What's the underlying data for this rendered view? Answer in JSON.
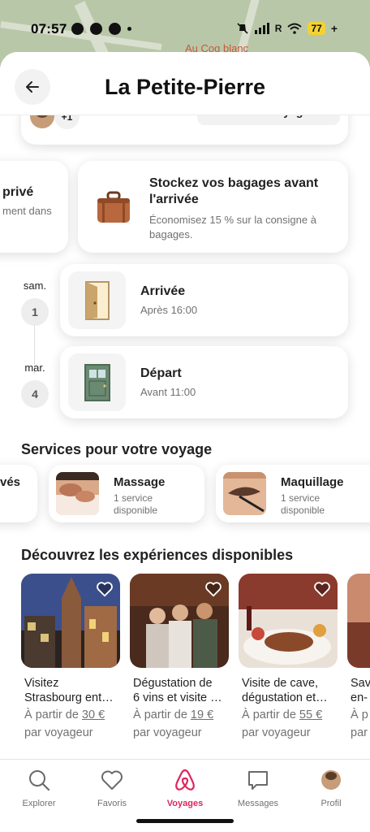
{
  "status_bar": {
    "time": "07:57",
    "network": "R",
    "battery": "77"
  },
  "map": {
    "label": "Au Coq blanc"
  },
  "header": {
    "title": "La Petite-Pierre"
  },
  "guests": {
    "extra_count": "+1",
    "invite_label": "Inviter des voyageurs"
  },
  "private_card": {
    "title": "privé",
    "subtitle": "ment dans"
  },
  "luggage_card": {
    "title": "Stockez vos bagages avant l'arrivée",
    "subtitle": "Économisez 15 % sur la consigne à bagages."
  },
  "schedule": [
    {
      "day_name": "sam.",
      "day_num": "1",
      "title": "Arrivée",
      "subtitle": "Après 16:00"
    },
    {
      "day_name": "mar.",
      "day_num": "4",
      "title": "Départ",
      "subtitle": "Avant 11:00"
    }
  ],
  "services": {
    "heading": "Services pour votre voyage",
    "items": [
      {
        "title": "vés",
        "subtitle": ""
      },
      {
        "title": "Massage",
        "subtitle": "1 service disponible"
      },
      {
        "title": "Maquillage",
        "subtitle": "1 service disponible"
      }
    ]
  },
  "experiences": {
    "heading": "Découvrez les expériences disponibles",
    "items": [
      {
        "name": "Visitez\nStrasbourg ent…",
        "price_prefix": "À partir de ",
        "price": "30 €",
        "per": "par voyageur"
      },
      {
        "name": "Dégustation de\n6 vins et visite …",
        "price_prefix": "À partir de ",
        "price": "19 €",
        "per": "par voyageur"
      },
      {
        "name": "Visite de cave,\ndégustation et…",
        "price_prefix": "À partir de ",
        "price": "55 €",
        "per": "par voyageur"
      },
      {
        "name": "Sav\nen-",
        "price_prefix": "À p",
        "price": "",
        "per": "par"
      }
    ]
  },
  "tabbar": {
    "tabs": [
      {
        "label": "Explorer",
        "icon": "search-icon"
      },
      {
        "label": "Favoris",
        "icon": "heart-icon"
      },
      {
        "label": "Voyages",
        "icon": "airbnb-logo-icon"
      },
      {
        "label": "Messages",
        "icon": "message-icon"
      },
      {
        "label": "Profil",
        "icon": "avatar"
      }
    ],
    "active": "Voyages",
    "accent": "#E0245E"
  }
}
